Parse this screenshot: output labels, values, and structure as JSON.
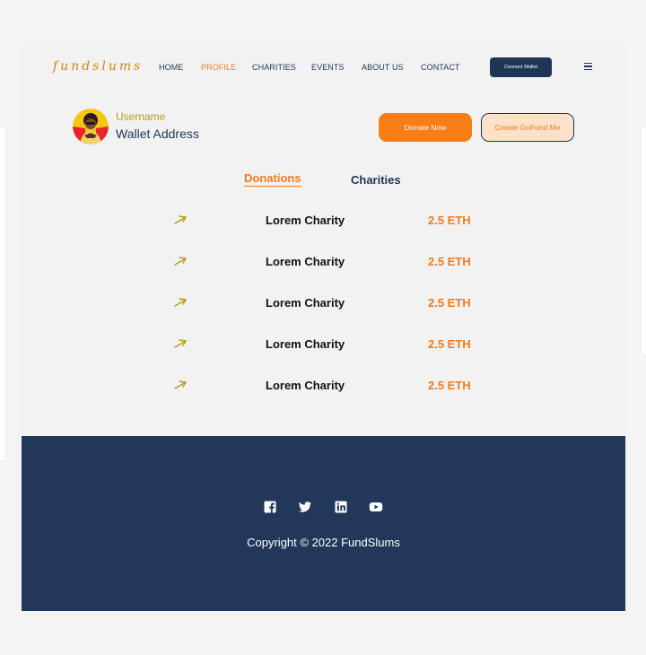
{
  "header": {
    "logo": "fundslums",
    "nav": [
      "HOME",
      "PROFILE",
      "CHARITIES",
      "EVENTS",
      "ABOUT US",
      "CONTACT"
    ],
    "active_nav": "PROFILE",
    "connect_label": "Connect Wallet"
  },
  "profile": {
    "username": "Username",
    "wallet": "Wallet Address",
    "donate_label": "Donate Now",
    "gofund_label": "Create GoFund Me"
  },
  "tabs": [
    "Donations",
    "Charities"
  ],
  "active_tab": "Donations",
  "donations": [
    {
      "charity": "Lorem Charity",
      "amount": "2.5 ETH"
    },
    {
      "charity": "Lorem Charity",
      "amount": "2.5 ETH"
    },
    {
      "charity": "Lorem Charity",
      "amount": "2.5 ETH"
    },
    {
      "charity": "Lorem Charity",
      "amount": "2.5 ETH"
    },
    {
      "charity": "Lorem Charity",
      "amount": "2.5 ETH"
    }
  ],
  "footer": {
    "social_icons": [
      "facebook-icon",
      "twitter-icon",
      "linkedin-icon",
      "youtube-icon"
    ],
    "copyright": "Copyright © 2022 FundSlums"
  },
  "colors": {
    "accent": "#f77d17",
    "navy": "#1f3557",
    "footer_bg": "#21385b",
    "username": "#b39a1c"
  }
}
